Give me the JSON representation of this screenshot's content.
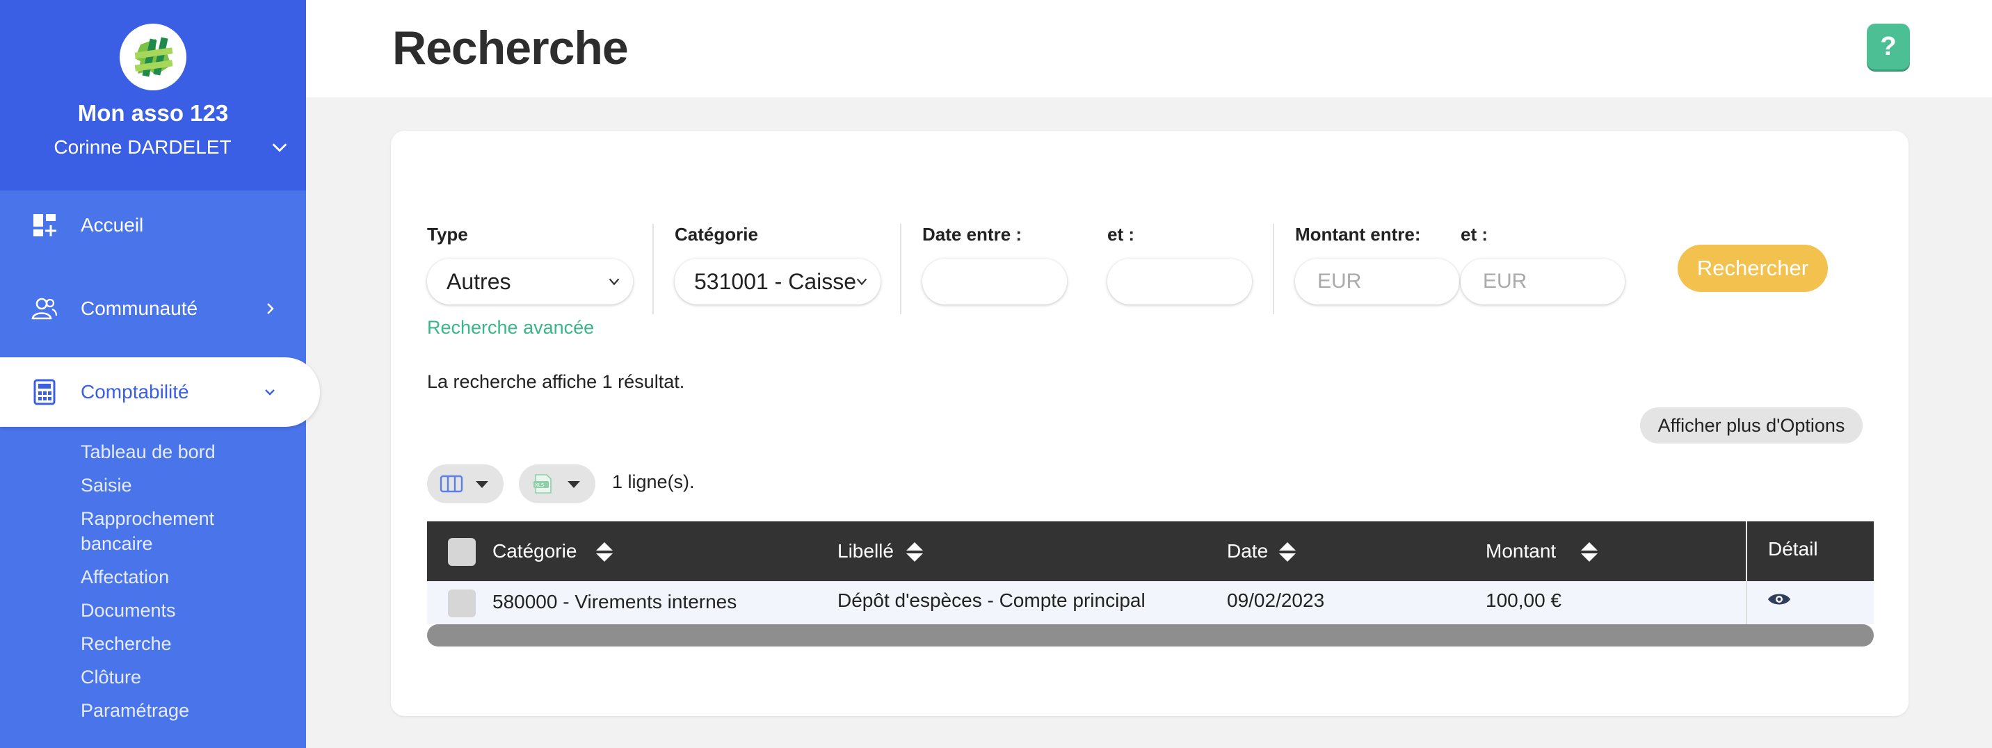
{
  "sidebar": {
    "org_name": "Mon asso 123",
    "user_name": "Corinne DARDELET",
    "nav": [
      {
        "label": "Accueil",
        "icon": "dashboard-icon"
      },
      {
        "label": "Communauté",
        "icon": "users-icon"
      },
      {
        "label": "Comptabilité",
        "icon": "calculator-icon",
        "active": true
      }
    ],
    "subnav": [
      "Tableau de bord",
      "Saisie",
      "Rapprochement",
      "bancaire",
      "Affectation",
      "Documents",
      "Recherche",
      "Clôture",
      "Paramétrage"
    ]
  },
  "header": {
    "title": "Recherche",
    "help_label": "?"
  },
  "filters": {
    "type_label": "Type",
    "type_value": "Autres",
    "category_label": "Catégorie",
    "category_value": "531001 - Caisse",
    "date_from_label": "Date entre :",
    "date_to_label": "et :",
    "amount_from_label": "Montant entre:",
    "amount_to_label": "et :",
    "amount_from_placeholder": "EUR",
    "amount_to_placeholder": "EUR",
    "search_button": "Rechercher",
    "advanced_link": "Recherche avancée"
  },
  "results": {
    "summary": "La recherche affiche 1 résultat.",
    "options_button": "Afficher plus d'Options",
    "rows_count": "1 ligne(s)."
  },
  "table": {
    "columns": [
      "Catégorie",
      "Libellé",
      "Date",
      "Montant",
      "Détail"
    ],
    "rows": [
      {
        "categorie": "580000 - Virements internes",
        "libelle": "Dépôt d'espèces - Compte principal",
        "date": "09/02/2023",
        "montant": "100,00 €"
      }
    ]
  },
  "colors": {
    "sidebar": "#4a74ea",
    "sidebar_head": "#3a5fe5",
    "accent_green": "#3bb58a",
    "search_button": "#f2c14e",
    "table_header": "#333333"
  }
}
